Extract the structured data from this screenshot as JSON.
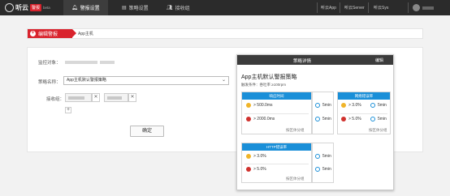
{
  "app": {
    "name": "听云",
    "badge": "警报",
    "tag": "beta"
  },
  "nav": [
    {
      "label": "警报设置",
      "icon": "bell-icon"
    },
    {
      "label": "策略设置",
      "icon": "strategy-icon"
    },
    {
      "label": "接收组",
      "icon": "group-icon"
    }
  ],
  "product_links": [
    "听云App",
    "听云Server",
    "听云Sys"
  ],
  "breadcrumb": {
    "section": "编辑警报",
    "item": "App主机"
  },
  "form": {
    "monitor_label": "监控对象：",
    "strategy_label": "策略名称：",
    "strategy_value": "App主机默认警报策略",
    "receiver_label": "接收组：",
    "confirm_label": "确定"
  },
  "popover": {
    "title": "策略详情",
    "edit": "编辑",
    "strategy_name": "App主机默认警报策略",
    "trigger": "触发条件：吞吐率 ≥100rpm",
    "cards": [
      {
        "title": "响应时间",
        "rows": [
          {
            "severity": "warning",
            "value": "> 500.0ms",
            "duration": "5min"
          },
          {
            "severity": "critical",
            "value": "> 2000.0ms",
            "duration": "5min"
          }
        ],
        "footer": "按区体分组"
      },
      {
        "title": "网络错误率",
        "rows": [
          {
            "severity": "warning",
            "value": "> 3.0%",
            "duration": "5min"
          },
          {
            "severity": "critical",
            "value": "> 5.0%",
            "duration": "5min"
          }
        ],
        "footer": "按区体分组"
      },
      {
        "title": "HTTP错误率",
        "rows": [
          {
            "severity": "warning",
            "value": "> 3.0%",
            "duration": "5min"
          },
          {
            "severity": "critical",
            "value": "> 5.0%",
            "duration": "5min"
          }
        ],
        "footer": "按区体分组"
      }
    ]
  },
  "colors": {
    "brand_red": "#d9232d",
    "card_blue": "#1a8fd8",
    "warning": "#f0b429",
    "critical": "#d0312d"
  }
}
